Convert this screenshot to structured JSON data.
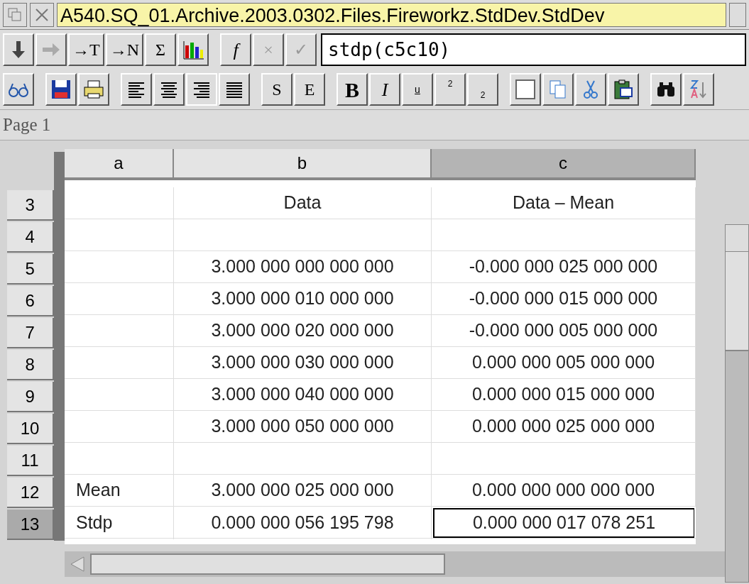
{
  "window": {
    "title": "A540.SQ_01.Archive.2003.0302.Files.Fireworkz.StdDev.StdDev"
  },
  "formula_bar": {
    "buttons": [
      {
        "kind": "down"
      },
      {
        "kind": "right"
      },
      {
        "kind": "text",
        "label": "→T"
      },
      {
        "kind": "text",
        "label": "→N"
      },
      {
        "kind": "text",
        "label": "Σ"
      },
      {
        "kind": "chart"
      },
      {
        "kind": "gap"
      },
      {
        "kind": "italic",
        "label": "f"
      },
      {
        "kind": "text",
        "label": "×",
        "disabled": true
      },
      {
        "kind": "text",
        "label": "✓",
        "disabled": true
      }
    ],
    "value": "stdp(c5c10)"
  },
  "format_bar": {
    "buttons": [
      {
        "kind": "view"
      },
      {
        "kind": "gap"
      },
      {
        "kind": "save"
      },
      {
        "kind": "print"
      },
      {
        "kind": "gap"
      },
      {
        "kind": "align-left",
        "selected": false
      },
      {
        "kind": "align-center",
        "selected": false
      },
      {
        "kind": "align-right",
        "selected": true
      },
      {
        "kind": "align-justify",
        "selected": false
      },
      {
        "kind": "gap"
      },
      {
        "kind": "text",
        "label": "S"
      },
      {
        "kind": "text",
        "label": "E"
      },
      {
        "kind": "gap"
      },
      {
        "kind": "bold",
        "label": "B"
      },
      {
        "kind": "italic",
        "label": "I"
      },
      {
        "kind": "underline",
        "label": "u"
      },
      {
        "kind": "superscript",
        "label": "2"
      },
      {
        "kind": "subscript",
        "label": "2"
      },
      {
        "kind": "gap"
      },
      {
        "kind": "box"
      },
      {
        "kind": "copy"
      },
      {
        "kind": "cut"
      },
      {
        "kind": "paste"
      },
      {
        "kind": "gap"
      },
      {
        "kind": "find"
      },
      {
        "kind": "sort"
      }
    ]
  },
  "page_label": "Page 1",
  "columns": [
    {
      "label": "a",
      "selected": false
    },
    {
      "label": "b",
      "selected": false
    },
    {
      "label": "c",
      "selected": true
    }
  ],
  "rows": [
    {
      "number": "3",
      "selected": false,
      "cells": [
        {
          "text": "",
          "current": false
        },
        {
          "text": "Data",
          "current": false
        },
        {
          "text": "Data – Mean",
          "current": false
        }
      ]
    },
    {
      "number": "4",
      "selected": false,
      "cells": [
        {
          "text": "",
          "current": false
        },
        {
          "text": "",
          "current": false
        },
        {
          "text": "",
          "current": false
        }
      ]
    },
    {
      "number": "5",
      "selected": false,
      "cells": [
        {
          "text": "",
          "current": false
        },
        {
          "text": "3.000 000 000 000 000",
          "current": false
        },
        {
          "text": "-0.000 000 025 000 000",
          "current": false
        }
      ]
    },
    {
      "number": "6",
      "selected": false,
      "cells": [
        {
          "text": "",
          "current": false
        },
        {
          "text": "3.000 000 010 000 000",
          "current": false
        },
        {
          "text": "-0.000 000 015 000 000",
          "current": false
        }
      ]
    },
    {
      "number": "7",
      "selected": false,
      "cells": [
        {
          "text": "",
          "current": false
        },
        {
          "text": "3.000 000 020 000 000",
          "current": false
        },
        {
          "text": "-0.000 000 005 000 000",
          "current": false
        }
      ]
    },
    {
      "number": "8",
      "selected": false,
      "cells": [
        {
          "text": "",
          "current": false
        },
        {
          "text": "3.000 000 030 000 000",
          "current": false
        },
        {
          "text": "0.000 000 005 000 000",
          "current": false
        }
      ]
    },
    {
      "number": "9",
      "selected": false,
      "cells": [
        {
          "text": "",
          "current": false
        },
        {
          "text": "3.000 000 040 000 000",
          "current": false
        },
        {
          "text": "0.000 000 015 000 000",
          "current": false
        }
      ]
    },
    {
      "number": "10",
      "selected": false,
      "cells": [
        {
          "text": "",
          "current": false
        },
        {
          "text": "3.000 000 050 000 000",
          "current": false
        },
        {
          "text": "0.000 000 025 000 000",
          "current": false
        }
      ]
    },
    {
      "number": "11",
      "selected": false,
      "cells": [
        {
          "text": "",
          "current": false
        },
        {
          "text": "",
          "current": false
        },
        {
          "text": "",
          "current": false
        }
      ]
    },
    {
      "number": "12",
      "selected": false,
      "cells": [
        {
          "text": "Mean",
          "current": false
        },
        {
          "text": "3.000 000 025 000 000",
          "current": false
        },
        {
          "text": "0.000 000 000 000 000",
          "current": false
        }
      ]
    },
    {
      "number": "13",
      "selected": true,
      "cells": [
        {
          "text": "Stdp",
          "current": false
        },
        {
          "text": "0.000 000 056 195 798",
          "current": false
        },
        {
          "text": "0.000 000 017 078 251",
          "current": true
        }
      ]
    }
  ]
}
